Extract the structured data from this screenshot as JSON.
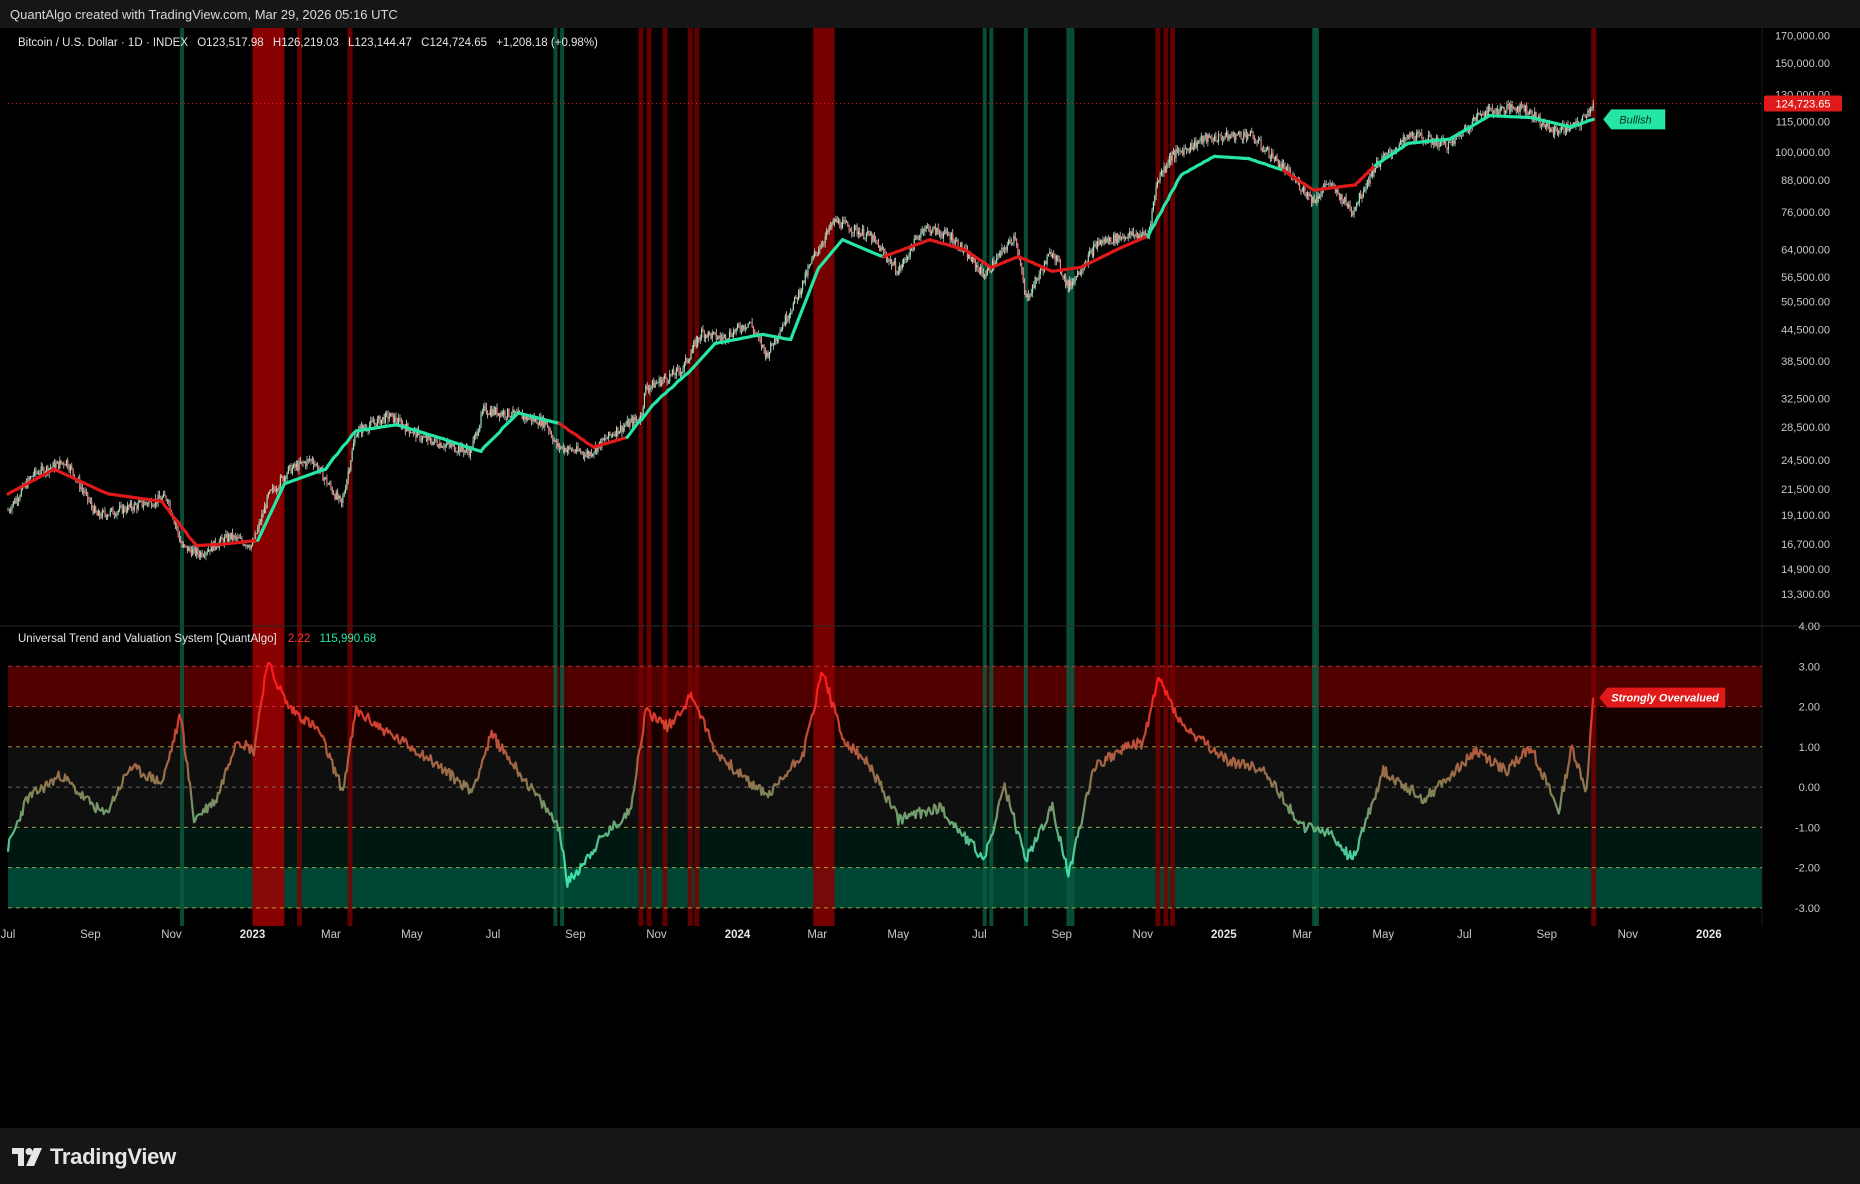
{
  "header": {
    "credit": "QuantAlgo created with TradingView.com, Mar 29, 2026 05:16 UTC"
  },
  "main_legend": {
    "symbol": "Bitcoin / U.S. Dollar · 1D · INDEX",
    "open": "O123,517.98",
    "high": "H126,219.03",
    "low": "L123,144.47",
    "close": "C124,724.65",
    "change": "+1,208.18 (+0.98%)"
  },
  "indicator_legend": {
    "name": "Universal Trend and Valuation System [QuantAlgo]",
    "value_score": "2.22",
    "value_trend": "115,990.68"
  },
  "labels": {
    "price_tag": "124,723.65",
    "bullish": "Bullish",
    "overvalued": "Strongly Overvalued"
  },
  "footer": {
    "brand": "TradingView"
  },
  "colors": {
    "background": "#000000",
    "bull": "#26e6a6",
    "bear": "#e01a1a",
    "red_zone": "#8b0000",
    "green_zone": "#006b4f",
    "dashed_yellow": "#c9c94a",
    "dashed_red": "#e04040"
  },
  "chart_data": [
    {
      "type": "line",
      "title": "Bitcoin / U.S. Dollar · 1D · INDEX",
      "scale": "log",
      "ylim": [
        11500,
        176000
      ],
      "xlim": [
        "2022-07-01",
        "2026-02-10"
      ],
      "y_ticks": [
        "170,000.00",
        "150,000.00",
        "130,000.00",
        "115,000.00",
        "100,000.00",
        "88,000.00",
        "76,000.00",
        "64,000.00",
        "56,500.00",
        "50,500.00",
        "44,500.00",
        "38,500.00",
        "32,500.00",
        "28,500.00",
        "24,500.00",
        "21,500.00",
        "19,100.00",
        "16,700.00",
        "14,900.00",
        "13,300.00"
      ],
      "current_price": 124723.65,
      "series": [
        {
          "name": "",
          "kind": "price",
          "x": [
            "2022-07-01",
            "2022-07-20",
            "2022-08-14",
            "2022-09-06",
            "2022-10-05",
            "2022-10-29",
            "2022-11-09",
            "2022-11-22",
            "2022-12-15",
            "2023-01-01",
            "2023-01-13",
            "2023-01-28",
            "2023-02-15",
            "2023-03-09",
            "2023-03-20",
            "2023-04-14",
            "2023-05-10",
            "2023-06-14",
            "2023-06-24",
            "2023-07-14",
            "2023-08-10",
            "2023-08-18",
            "2023-09-11",
            "2023-10-01",
            "2023-10-20",
            "2023-10-24",
            "2023-11-20",
            "2023-12-05",
            "2023-12-20",
            "2024-01-10",
            "2024-01-23",
            "2024-02-15",
            "2024-02-28",
            "2024-03-14",
            "2024-04-10",
            "2024-05-01",
            "2024-05-20",
            "2024-06-10",
            "2024-07-05",
            "2024-07-28",
            "2024-08-05",
            "2024-08-25",
            "2024-09-06",
            "2024-09-28",
            "2024-10-20",
            "2024-11-05",
            "2024-11-12",
            "2024-11-22",
            "2024-12-17",
            "2025-01-20",
            "2025-02-10",
            "2025-03-10",
            "2025-03-20",
            "2025-04-08",
            "2025-04-25",
            "2025-05-22",
            "2025-06-20",
            "2025-07-14",
            "2025-08-14",
            "2025-09-05",
            "2025-09-25",
            "2025-10-06"
          ],
          "values": [
            19500,
            23000,
            24400,
            19000,
            19900,
            20700,
            16500,
            16000,
            17300,
            16600,
            20800,
            23400,
            24600,
            20000,
            27900,
            30000,
            27000,
            25500,
            30800,
            30300,
            29100,
            26100,
            25200,
            28000,
            29800,
            34000,
            37000,
            43900,
            42700,
            46000,
            39600,
            51700,
            62500,
            73000,
            68000,
            58000,
            71000,
            68000,
            57000,
            68500,
            51000,
            64000,
            54000,
            66000,
            68400,
            68500,
            88000,
            98000,
            106000,
            108500,
            96000,
            80000,
            87000,
            76500,
            94000,
            108000,
            103000,
            120000,
            123000,
            110000,
            113000,
            124724
          ]
        },
        {
          "name": "",
          "kind": "trend",
          "x": [
            "2022-07-01",
            "2022-08-05",
            "2022-09-15",
            "2022-10-25",
            "2022-11-20",
            "2022-12-10",
            "2023-01-05",
            "2023-01-25",
            "2023-02-25",
            "2023-03-20",
            "2023-04-20",
            "2023-05-25",
            "2023-06-22",
            "2023-07-20",
            "2023-08-20",
            "2023-09-15",
            "2023-10-10",
            "2023-11-01",
            "2023-11-25",
            "2023-12-15",
            "2024-01-20",
            "2024-02-10",
            "2024-03-01",
            "2024-03-20",
            "2024-04-20",
            "2024-05-25",
            "2024-06-20",
            "2024-07-10",
            "2024-07-31",
            "2024-08-25",
            "2024-09-15",
            "2024-10-15",
            "2024-11-05",
            "2024-11-30",
            "2024-12-25",
            "2025-01-20",
            "2025-02-15",
            "2025-03-10",
            "2025-04-10",
            "2025-04-25",
            "2025-05-20",
            "2025-06-20",
            "2025-07-20",
            "2025-08-20",
            "2025-09-20",
            "2025-10-06"
          ],
          "values": [
            21000,
            23500,
            21000,
            20300,
            16600,
            16700,
            17000,
            22000,
            23500,
            28000,
            28800,
            27000,
            25500,
            30400,
            29000,
            26000,
            27200,
            32000,
            36500,
            41700,
            43500,
            42500,
            58000,
            67000,
            62000,
            67000,
            64000,
            59000,
            62000,
            58000,
            59000,
            64500,
            68000,
            90000,
            98000,
            97000,
            92000,
            84000,
            86000,
            94000,
            104000,
            106000,
            118000,
            117000,
            112000,
            116000
          ],
          "direction": [
            "bear",
            "bear",
            "bear",
            "bear",
            "bear",
            "bear",
            "bull",
            "bull",
            "bull",
            "bull",
            "bull",
            "bull",
            "bull",
            "bull",
            "bear",
            "bear",
            "bull",
            "bull",
            "bull",
            "bull",
            "bull",
            "bull",
            "bull",
            "bull",
            "bear",
            "bear",
            "bear",
            "bear",
            "bear",
            "bear",
            "bear",
            "bear",
            "bull",
            "bull",
            "bull",
            "bull",
            "bear",
            "bear",
            "bear",
            "bull",
            "bull",
            "bull",
            "bull",
            "bull",
            "bull",
            "bull"
          ]
        }
      ]
    },
    {
      "type": "line",
      "title": "Universal Trend and Valuation System [QuantAlgo]",
      "ylim": [
        -3.45,
        4.0
      ],
      "xlim": [
        "2022-07-01",
        "2026-02-10"
      ],
      "y_ticks": [
        "4.00",
        "3.00",
        "2.00",
        "1.00",
        "0.00",
        "-1.00",
        "-2.00",
        "-3.00"
      ],
      "levels": [
        3,
        2,
        1,
        0,
        -1,
        -2,
        -3
      ],
      "series": [
        {
          "name": "",
          "x": [
            "2022-07-01",
            "2022-07-15",
            "2022-08-10",
            "2022-08-25",
            "2022-09-12",
            "2022-10-01",
            "2022-10-25",
            "2022-11-08",
            "2022-11-18",
            "2022-12-05",
            "2022-12-20",
            "2023-01-02",
            "2023-01-12",
            "2023-01-28",
            "2023-02-20",
            "2023-03-10",
            "2023-03-20",
            "2023-04-15",
            "2023-05-10",
            "2023-06-15",
            "2023-06-30",
            "2023-07-20",
            "2023-08-20",
            "2023-08-26",
            "2023-09-20",
            "2023-10-12",
            "2023-10-24",
            "2023-11-10",
            "2023-11-28",
            "2023-12-15",
            "2024-01-10",
            "2024-01-25",
            "2024-02-20",
            "2024-03-05",
            "2024-03-20",
            "2024-04-10",
            "2024-05-01",
            "2024-06-01",
            "2024-07-05",
            "2024-07-20",
            "2024-08-05",
            "2024-08-25",
            "2024-09-06",
            "2024-09-25",
            "2024-10-20",
            "2024-11-01",
            "2024-11-13",
            "2024-12-01",
            "2025-01-01",
            "2025-02-01",
            "2025-03-01",
            "2025-03-20",
            "2025-04-08",
            "2025-05-01",
            "2025-06-01",
            "2025-07-10",
            "2025-08-01",
            "2025-08-20",
            "2025-09-10",
            "2025-09-20",
            "2025-10-01",
            "2025-10-06"
          ],
          "values": [
            -1.5,
            -0.3,
            0.3,
            -0.2,
            -0.7,
            0.5,
            0.1,
            1.8,
            -0.8,
            -0.3,
            1.2,
            0.9,
            3.1,
            2.0,
            1.4,
            -0.1,
            1.9,
            1.3,
            0.8,
            -0.1,
            1.3,
            0.4,
            -1.0,
            -2.4,
            -1.3,
            -0.6,
            1.9,
            1.5,
            2.3,
            0.9,
            0.1,
            -0.2,
            0.9,
            2.9,
            1.2,
            0.5,
            -0.8,
            -0.5,
            -1.8,
            0.0,
            -1.8,
            -0.5,
            -2.2,
            0.5,
            1.0,
            1.1,
            2.7,
            1.5,
            0.7,
            0.4,
            -1.0,
            -1.1,
            -1.8,
            0.4,
            -0.3,
            0.9,
            0.4,
            1.0,
            -0.6,
            1.0,
            -0.1,
            2.22
          ]
        }
      ]
    }
  ],
  "signals": {
    "red_bands": [
      [
        "2023-01-01",
        "2023-01-25"
      ]
    ],
    "red_lines": [
      "2023-02-05",
      "2023-03-15",
      "2023-10-20",
      "2023-10-26",
      "2023-11-07",
      "2023-11-26",
      "2023-12-01",
      "2024-11-12",
      "2024-11-18",
      "2024-11-23",
      "2025-10-06"
    ],
    "red_wide": [
      [
        "2024-02-27",
        "2024-03-14"
      ]
    ],
    "green_lines": [
      "2022-11-09",
      "2023-08-17",
      "2023-08-22",
      "2024-07-05",
      "2024-07-10",
      "2024-08-05",
      "2024-09-06",
      "2024-09-09",
      "2025-03-10",
      "2025-03-12"
    ]
  },
  "x_axis": [
    {
      "label": "Jul",
      "date": "2022-07-01"
    },
    {
      "label": "Sep",
      "date": "2022-09-01"
    },
    {
      "label": "Nov",
      "date": "2022-11-01"
    },
    {
      "label": "2023",
      "date": "2023-01-01"
    },
    {
      "label": "Mar",
      "date": "2023-03-01"
    },
    {
      "label": "May",
      "date": "2023-05-01"
    },
    {
      "label": "Jul",
      "date": "2023-07-01"
    },
    {
      "label": "Sep",
      "date": "2023-09-01"
    },
    {
      "label": "Nov",
      "date": "2023-11-01"
    },
    {
      "label": "2024",
      "date": "2024-01-01"
    },
    {
      "label": "Mar",
      "date": "2024-03-01"
    },
    {
      "label": "May",
      "date": "2024-05-01"
    },
    {
      "label": "Jul",
      "date": "2024-07-01"
    },
    {
      "label": "Sep",
      "date": "2024-09-01"
    },
    {
      "label": "Nov",
      "date": "2024-11-01"
    },
    {
      "label": "2025",
      "date": "2025-01-01"
    },
    {
      "label": "Mar",
      "date": "2025-03-01"
    },
    {
      "label": "May",
      "date": "2025-05-01"
    },
    {
      "label": "Jul",
      "date": "2025-07-01"
    },
    {
      "label": "Sep",
      "date": "2025-09-01"
    },
    {
      "label": "Nov",
      "date": "2025-11-01"
    },
    {
      "label": "2026",
      "date": "2026-01-01"
    }
  ]
}
